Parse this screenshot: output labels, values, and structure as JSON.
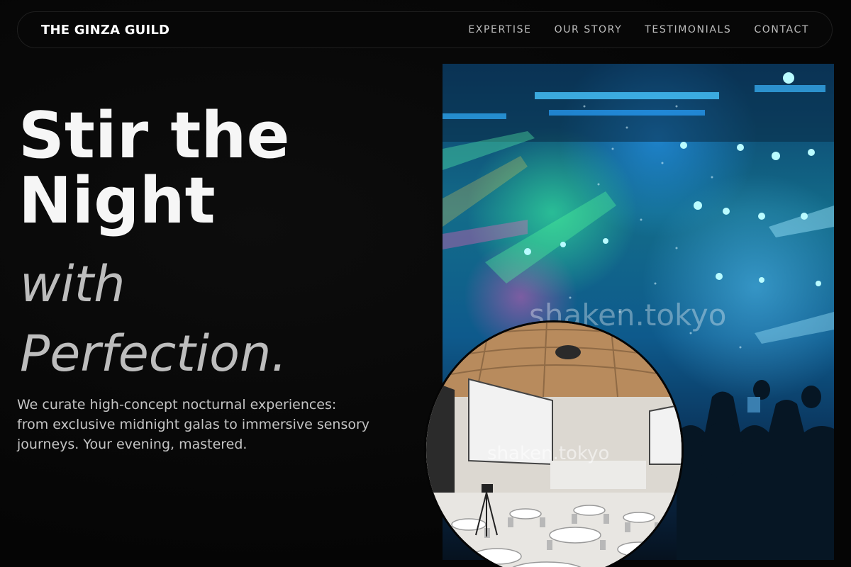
{
  "nav": {
    "brand": "THE GINZA GUILD",
    "links": [
      {
        "label": "EXPERTISE"
      },
      {
        "label": "OUR STORY"
      },
      {
        "label": "TESTIMONIALS"
      },
      {
        "label": "CONTACT"
      }
    ]
  },
  "hero": {
    "title_line1": "Stir the",
    "title_line2": "Night",
    "accent_line1": "with",
    "accent_line2": "Perfection.",
    "description": "We curate high-concept nocturnal experiences: from exclusive midnight galas to immersive sensory journeys. Your evening, mastered."
  },
  "images": {
    "concert": {
      "watermark": "shaken.tokyo"
    },
    "venue": {
      "watermark": "shaken.tokyo"
    }
  },
  "colors": {
    "background": "#050505",
    "nav_border": "#1f1f1f",
    "title": "#f6f6f6",
    "accent_text": "#bdbdbd",
    "body_text": "#c4c4c4"
  }
}
